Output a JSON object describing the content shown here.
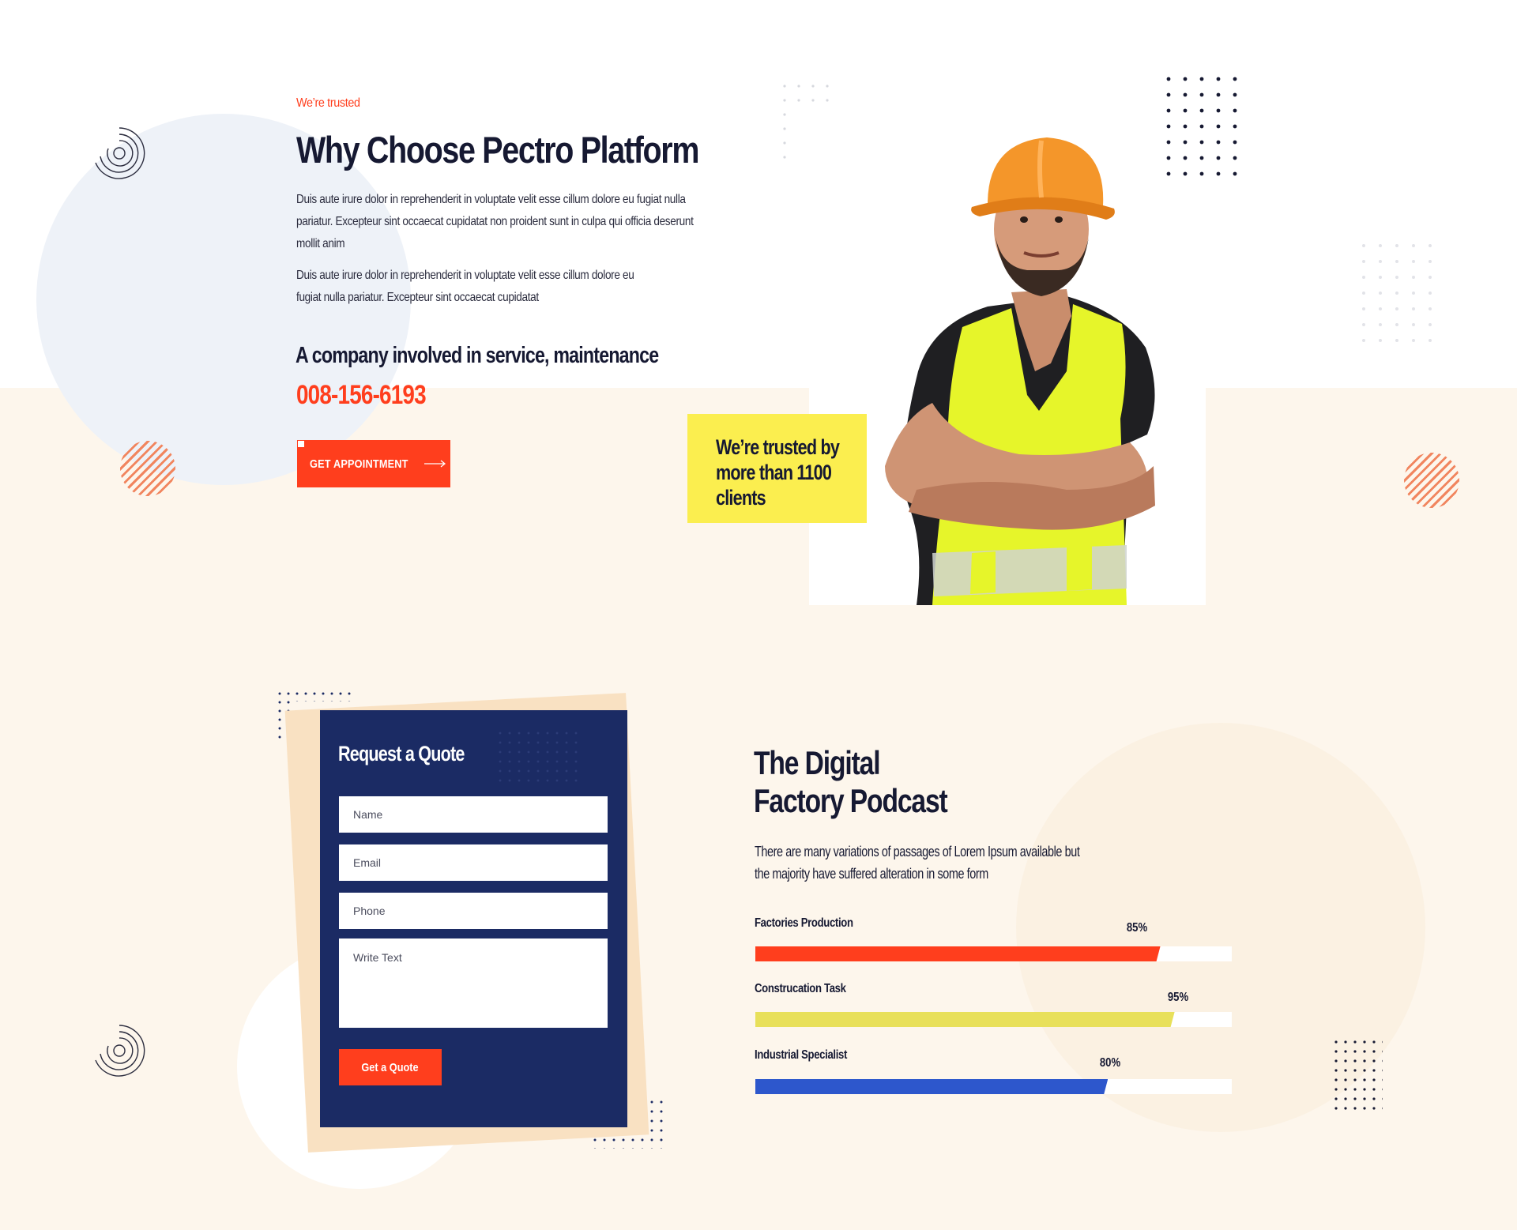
{
  "about": {
    "eyebrow": "We’re trusted",
    "title": "Why Choose Pectro Platform",
    "paragraph1": "Duis aute irure dolor in reprehenderit in voluptate velit esse cillum dolore eu fugiat nulla pariatur. Excepteur sint occaecat cupidatat non proident sunt in culpa qui officia deserunt mollit anim",
    "paragraph2": "Duis aute irure dolor in reprehenderit in voluptate velit esse cillum dolore eu fugiat nulla pariatur. Excepteur sint occaecat cupidatat",
    "subheading": "A company involved in service, maintenance",
    "phone": "008-156-6193",
    "button_label": "GET APPOINTMENT",
    "badge_text": "We’re trusted by more than 1100 clients"
  },
  "quote_form": {
    "title": "Request a Quote",
    "name_placeholder": "Name",
    "email_placeholder": "Email",
    "phone_placeholder": "Phone",
    "message_placeholder": "Write Text",
    "submit_label": "Get a Quote"
  },
  "podcast": {
    "title_line1": "The Digital",
    "title_line2": "Factory Podcast",
    "text": "There are many variations of passages of Lorem Ipsum available but the majority have suffered alteration in some form",
    "bars": [
      {
        "label": "Factories Production",
        "percent_label": "85%",
        "value": 0.85,
        "color": "#ff3e1d"
      },
      {
        "label": "Construcation Task",
        "percent_label": "95%",
        "value": 0.88,
        "color": "#e8e05a"
      },
      {
        "label": "Industrial Specialist",
        "percent_label": "80%",
        "value": 0.74,
        "color": "#2d57cc"
      }
    ]
  },
  "colors": {
    "accent": "#ff3e1d",
    "navy": "#1b2b64",
    "yellow": "#fbee4f",
    "cream": "#fdf6ec"
  }
}
